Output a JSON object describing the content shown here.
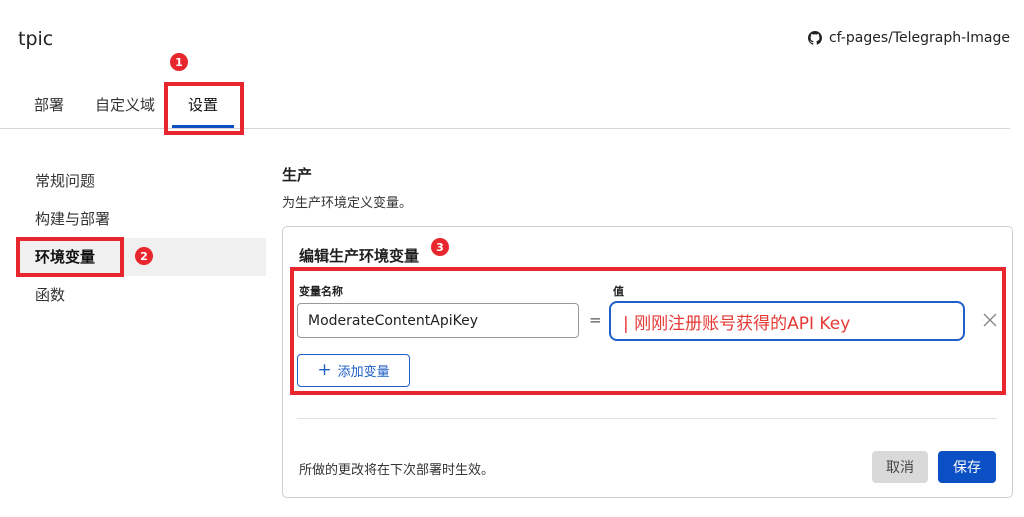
{
  "header": {
    "project_name": "tpic",
    "repo_label": "cf-pages/Telegraph-Image",
    "repo_icon": "github-icon"
  },
  "tabs": [
    {
      "label": "部署"
    },
    {
      "label": "自定义域"
    },
    {
      "label": "设置",
      "active": true
    }
  ],
  "sidebar": {
    "items": [
      {
        "label": "常规问题"
      },
      {
        "label": "构建与部署"
      },
      {
        "label": "环境变量",
        "active": true
      },
      {
        "label": "函数"
      }
    ]
  },
  "section": {
    "title": "生产",
    "description": "为生产环境定义变量。"
  },
  "card": {
    "title": "编辑生产环境变量",
    "name_label": "变量名称",
    "value_label": "值",
    "name_value": "ModerateContentApiKey",
    "equals": "=",
    "value_value": "| 刚刚注册账号获得的API Key",
    "add_label": "添加变量",
    "add_icon": "+",
    "footer_note": "所做的更改将在下次部署时生效。",
    "cancel_label": "取消",
    "save_label": "保存"
  },
  "annotations": {
    "badges": [
      "1",
      "2",
      "3"
    ],
    "color": "#e8262d"
  },
  "colors": {
    "accent": "#0a4fc4",
    "annotation_red": "#e8262d",
    "value_text": "#e53935"
  }
}
